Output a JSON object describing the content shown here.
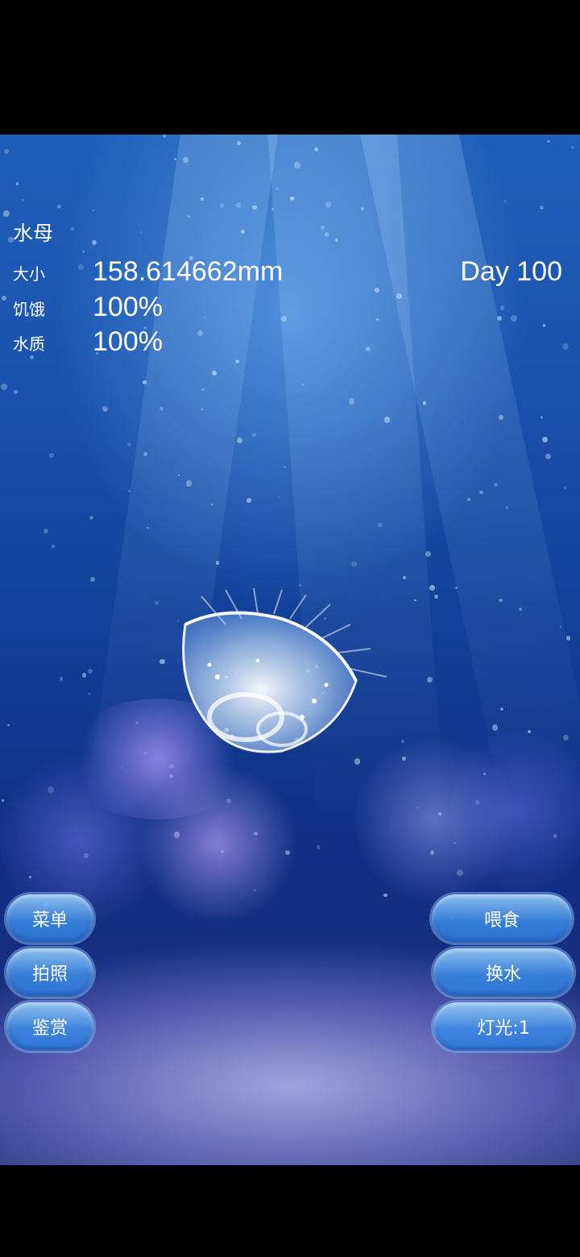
{
  "hud": {
    "name_label": "水母",
    "size_label": "大小",
    "size_value": "158.614662mm",
    "day_value": "Day 100",
    "hunger_label": "饥饿",
    "hunger_value": "100%",
    "water_label": "水质",
    "water_value": "100%"
  },
  "left_buttons": [
    "菜单",
    "拍照",
    "鉴赏"
  ],
  "right_buttons": [
    "喂食",
    "换水",
    "灯光:1"
  ],
  "colors": {
    "water_top": "#1f5fb9",
    "water_deep": "#0f2f84",
    "button": "#3c8ce6"
  }
}
